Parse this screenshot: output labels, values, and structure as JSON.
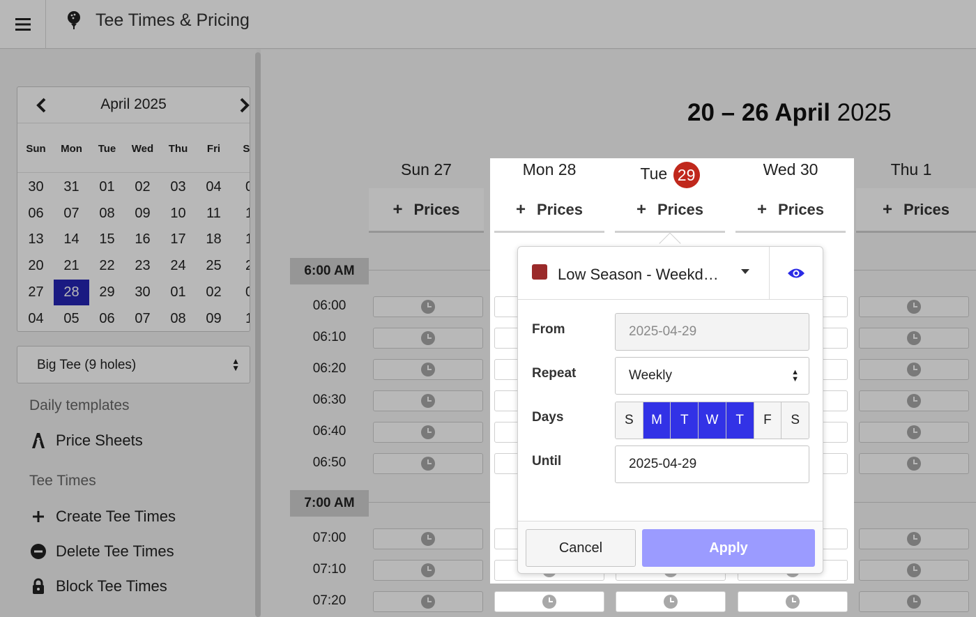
{
  "app": {
    "title": "Tee Times & Pricing"
  },
  "calendar": {
    "month_label": "April 2025",
    "weekdays": [
      "Sun",
      "Mon",
      "Tue",
      "Wed",
      "Thu",
      "Fri",
      "Sa"
    ],
    "weeks": [
      [
        "30",
        "31",
        "01",
        "02",
        "03",
        "04",
        "0"
      ],
      [
        "06",
        "07",
        "08",
        "09",
        "10",
        "11",
        "1"
      ],
      [
        "13",
        "14",
        "15",
        "16",
        "17",
        "18",
        "1"
      ],
      [
        "20",
        "21",
        "22",
        "23",
        "24",
        "25",
        "2"
      ],
      [
        "27",
        "28",
        "29",
        "30",
        "01",
        "02",
        "0"
      ],
      [
        "04",
        "05",
        "06",
        "07",
        "08",
        "09",
        "1"
      ]
    ],
    "selected": "28"
  },
  "course_select": {
    "value": "Big Tee (9 holes)"
  },
  "sidebar": {
    "daily_templates_heading": "Daily templates",
    "price_sheets": "Price Sheets",
    "tee_times_heading": "Tee Times",
    "create": "Create Tee Times",
    "delete": "Delete Tee Times",
    "block": "Block Tee Times"
  },
  "week": {
    "range": "20 – 26 April",
    "year": "2025"
  },
  "days": {
    "sun": "Sun 27",
    "mon": "Mon 28",
    "tue_name": "Tue",
    "tue_num": "29",
    "wed": "Wed 30",
    "thu": "Thu 1"
  },
  "prices_button": {
    "plus": "+",
    "label": "Prices"
  },
  "hours": [
    "6:00 AM",
    "7:00 AM"
  ],
  "times": [
    "06:00",
    "06:10",
    "06:20",
    "06:30",
    "06:40",
    "06:50",
    "07:00",
    "07:10",
    "07:20"
  ],
  "popover": {
    "template_name": "Low Season - Weekd…",
    "template_color": "#9a2a2a",
    "from_label": "From",
    "from_value": "2025-04-29",
    "repeat_label": "Repeat",
    "repeat_value": "Weekly",
    "days_label": "Days",
    "day_letters": [
      "S",
      "M",
      "T",
      "W",
      "T",
      "F",
      "S"
    ],
    "days_on": [
      false,
      true,
      true,
      true,
      true,
      false,
      false
    ],
    "until_label": "Until",
    "until_value": "2025-04-29",
    "cancel": "Cancel",
    "apply": "Apply"
  },
  "colors": {
    "accent": "#3232e6",
    "apply_disabled": "#9b9bff",
    "today_badge": "#c0281c",
    "selected_day": "#2525b5"
  }
}
